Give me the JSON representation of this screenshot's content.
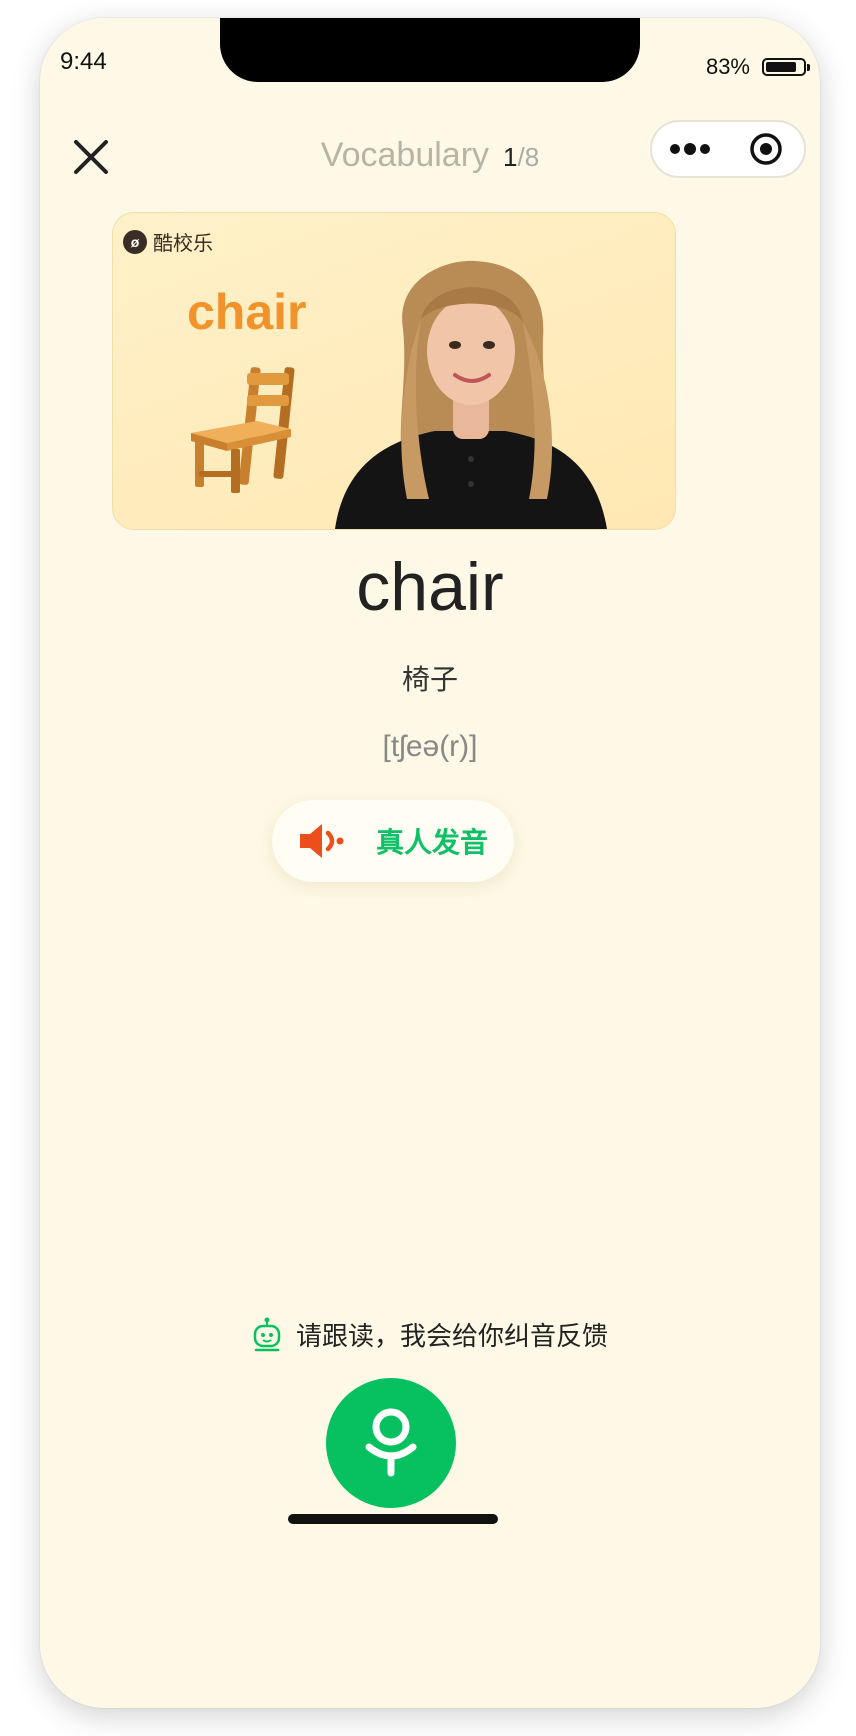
{
  "status_bar": {
    "time": "9:44",
    "battery_percent": "83%",
    "battery_level": 0.83
  },
  "nav": {
    "title": "Vocabulary",
    "current": "1",
    "total": "/8",
    "close_icon": "close-icon",
    "more_icon": "more-dots-icon",
    "target_icon": "target-icon"
  },
  "hero": {
    "brand": "酷校乐",
    "word": "chair",
    "accent_color": "#F2922A",
    "illustration": "chair-illustration",
    "presenter": "presenter-photo"
  },
  "card": {
    "word": "chair",
    "meaning": "椅子",
    "phonetic": "[tʃeə(r)]"
  },
  "pronounce_button": {
    "label": "真人发音",
    "icon": "speaker-icon",
    "color": "#10C066"
  },
  "hint": {
    "text": "请跟读，我会给你纠音反馈",
    "icon": "robot-icon"
  },
  "mic_button": {
    "icon": "microphone-icon",
    "color": "#07C160"
  },
  "colors": {
    "background": "#FEF9E6",
    "brand_green": "#07C160",
    "accent_orange": "#F2922A"
  }
}
